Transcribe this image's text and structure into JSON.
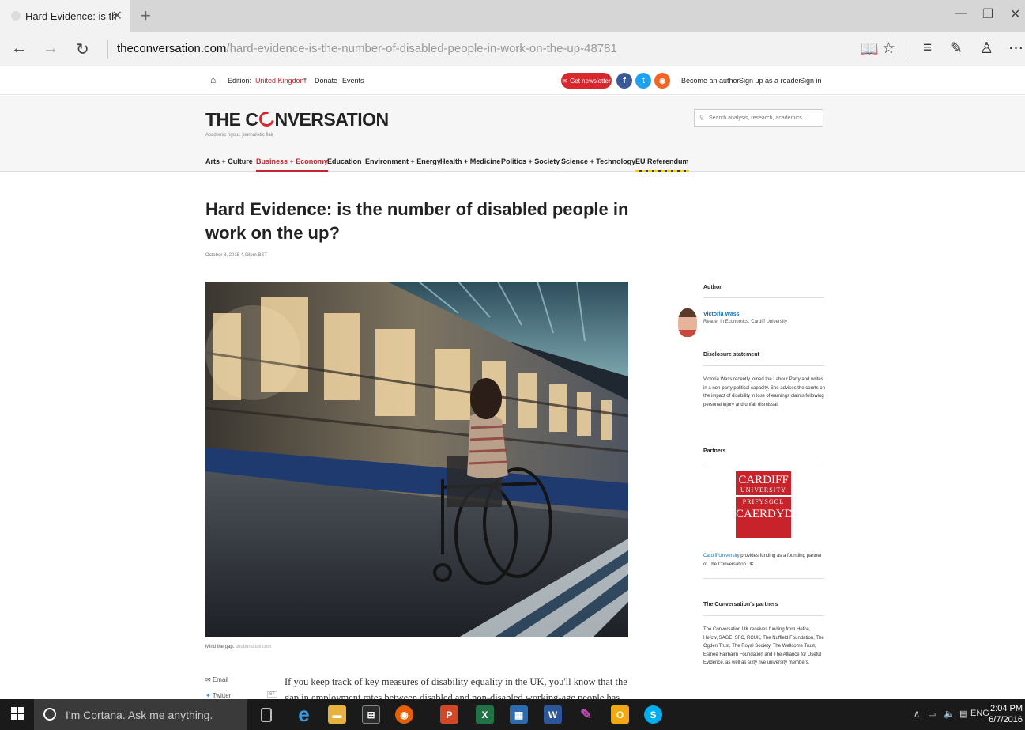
{
  "browser": {
    "tab_title": "Hard Evidence: is the nu",
    "url_domain": "theconversation.com",
    "url_path": "/hard-evidence-is-the-number-of-disabled-people-in-work-on-the-up-48781"
  },
  "utilbar": {
    "edition_label": "Edition:",
    "edition_value": "United Kingdom",
    "donate": "Donate",
    "events": "Events",
    "newsletter": "Get newsletter",
    "become_author": "Become an author",
    "signup_reader": "Sign up as a reader",
    "signin": "Sign in"
  },
  "masthead": {
    "logo_pre": "THE C",
    "logo_post": "NVERSATION",
    "tagline": "Academic rigour, journalistic flair",
    "search_placeholder": "Search analysis, research, academics…",
    "categories": [
      "Arts + Culture",
      "Business + Economy",
      "Education",
      "Environment + Energy",
      "Health + Medicine",
      "Politics + Society",
      "Science + Technology",
      "EU Referendum"
    ]
  },
  "article": {
    "headline": "Hard Evidence: is the number of disabled people in work on the up?",
    "date": "October 8, 2015 4.08pm BST",
    "caption": "Mind the gap.",
    "credit": "shutterstock.com",
    "share_email": "Email",
    "share_twitter": "Twitter",
    "share_count": "67",
    "body": "If you keep track of key measures of disability equality in the UK, you'll know that the gap in employment rates between disabled and non-disabled working-age people has gone"
  },
  "sidebar": {
    "author_heading": "Author",
    "author_name": "Victoria Wass",
    "author_role": "Reader in Economics, Cardiff University",
    "disclosure_heading": "Disclosure statement",
    "disclosure_text": "Victoria Wass recently joined the Labour Party and writes in a non-party political capacity. She advises the courts on the impact of disability in loss of earnings claims following personal injury and unfair dismissal.",
    "partners_heading": "Partners",
    "cardiff_logo_line1": "CARDIFF",
    "cardiff_logo_line2": "UNIVERSITY",
    "cardiff_logo_line3": "PRIFYSGOL",
    "cardiff_logo_line4": "CAERDYD",
    "partners_link": "Cardiff University",
    "partners_text": "provides funding as a founding partner of The Conversation UK.",
    "conv_partners_heading": "The Conversation's partners",
    "conv_partners_text": "The Conversation UK receives funding from Hefce, Hefcw, SAGE, SFC, RCUK, The Nuffield Foundation, The Ogden Trust, The Royal Society, The Wellcome Trust, Esmée Fairbairn Foundation and The Alliance for Useful Evidence, as well as sixty five university members."
  },
  "taskbar": {
    "cortana": "I'm Cortana. Ask me anything.",
    "lang": "ENG",
    "time": "2:04 PM",
    "date": "6/7/2016"
  },
  "colors": {
    "brand_red": "#d8272d",
    "link_blue": "#1a73b5"
  }
}
